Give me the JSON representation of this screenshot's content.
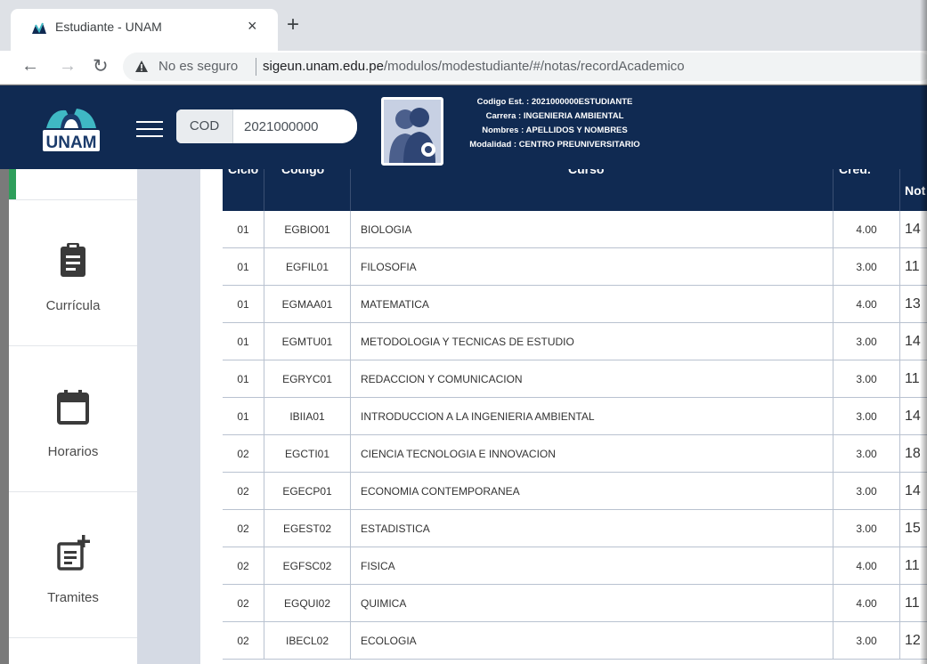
{
  "browser": {
    "tab_title": "Estudiante - UNAM",
    "tab_close": "×",
    "new_tab": "+",
    "security_label": "No es seguro",
    "url_host": "sigeun.unam.edu.pe",
    "url_path": "/modulos/modestudiante/#/notas/recordAcademico"
  },
  "header": {
    "logo_text": "UNAM",
    "cod_label": "COD",
    "cod_value": "2021000000",
    "info_codigo": "Codigo Est. : 2021000000ESTUDIANTE",
    "info_carrera": "Carrera : INGENIERIA AMBIENTAL",
    "info_nombres": "Nombres : APELLIDOS Y NOMBRES",
    "info_modalidad": "Modalidad : CENTRO PREUNIVERSITARIO"
  },
  "sidebar": {
    "items": [
      {
        "label": "Currícula",
        "icon": "clipboard-icon"
      },
      {
        "label": "Horarios",
        "icon": "calendar-icon"
      },
      {
        "label": "Tramites",
        "icon": "document-add-icon"
      }
    ]
  },
  "table": {
    "headers": [
      "Ciclo",
      "Codigo",
      "Curso",
      "Cred.",
      "Not"
    ],
    "rows": [
      {
        "ciclo": "01",
        "codigo": "EGBIO01",
        "curso": "BIOLOGIA",
        "cred": "4.00",
        "nota": "14"
      },
      {
        "ciclo": "01",
        "codigo": "EGFIL01",
        "curso": "FILOSOFIA",
        "cred": "3.00",
        "nota": "11"
      },
      {
        "ciclo": "01",
        "codigo": "EGMAA01",
        "curso": "MATEMATICA",
        "cred": "4.00",
        "nota": "13"
      },
      {
        "ciclo": "01",
        "codigo": "EGMTU01",
        "curso": "METODOLOGIA Y TECNICAS DE ESTUDIO",
        "cred": "3.00",
        "nota": "14"
      },
      {
        "ciclo": "01",
        "codigo": "EGRYC01",
        "curso": "REDACCION Y COMUNICACION",
        "cred": "3.00",
        "nota": "11"
      },
      {
        "ciclo": "01",
        "codigo": "IBIIA01",
        "curso": "INTRODUCCION A LA INGENIERIA AMBIENTAL",
        "cred": "3.00",
        "nota": "14"
      },
      {
        "ciclo": "02",
        "codigo": "EGCTI01",
        "curso": "CIENCIA TECNOLOGIA E INNOVACION",
        "cred": "3.00",
        "nota": "18"
      },
      {
        "ciclo": "02",
        "codigo": "EGECP01",
        "curso": "ECONOMIA CONTEMPORANEA",
        "cred": "3.00",
        "nota": "14"
      },
      {
        "ciclo": "02",
        "codigo": "EGEST02",
        "curso": "ESTADISTICA",
        "cred": "3.00",
        "nota": "15"
      },
      {
        "ciclo": "02",
        "codigo": "EGFSC02",
        "curso": "FISICA",
        "cred": "4.00",
        "nota": "11"
      },
      {
        "ciclo": "02",
        "codigo": "EGQUI02",
        "curso": "QUIMICA",
        "cred": "4.00",
        "nota": "11"
      },
      {
        "ciclo": "02",
        "codigo": "IBECL02",
        "curso": "ECOLOGIA",
        "cred": "3.00",
        "nota": "12"
      }
    ]
  },
  "colors": {
    "header_bg": "#102a52",
    "active_accent": "#2e9e5b",
    "logo_teal": "#3fb8c4"
  }
}
